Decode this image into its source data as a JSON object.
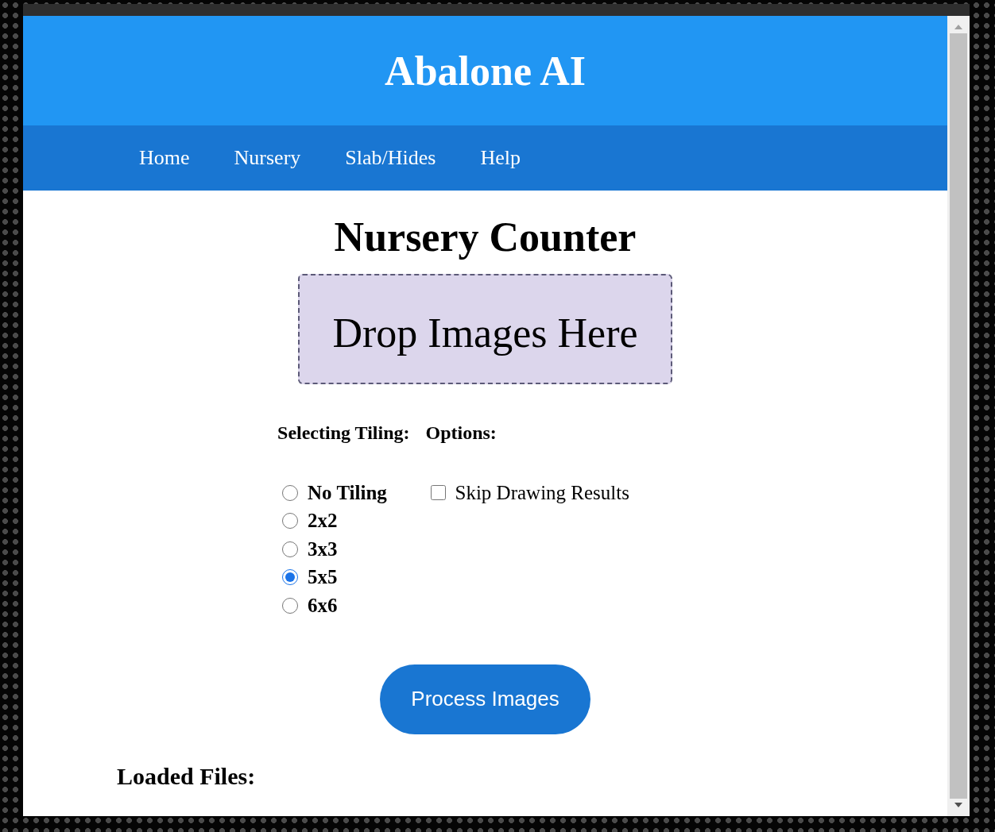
{
  "header": {
    "title": "Abalone AI"
  },
  "nav": {
    "items": [
      {
        "label": "Home"
      },
      {
        "label": "Nursery"
      },
      {
        "label": "Slab/Hides"
      },
      {
        "label": "Help"
      }
    ]
  },
  "page": {
    "heading": "Nursery Counter",
    "dropzone": "Drop Images Here"
  },
  "tiling": {
    "label": "Selecting Tiling:",
    "options": [
      {
        "label": "No Tiling",
        "selected": false
      },
      {
        "label": "2x2",
        "selected": false
      },
      {
        "label": "3x3",
        "selected": false
      },
      {
        "label": "5x5",
        "selected": true
      },
      {
        "label": "6x6",
        "selected": false
      }
    ]
  },
  "options": {
    "label": "Options:",
    "items": [
      {
        "label": "Skip Drawing Results",
        "checked": false
      }
    ]
  },
  "process_button": "Process Images",
  "loaded_files": {
    "label": "Loaded Files:"
  }
}
